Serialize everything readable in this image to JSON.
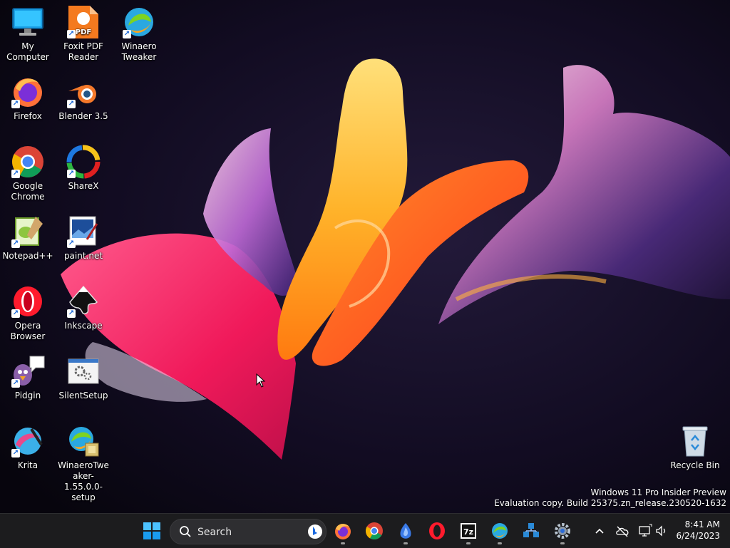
{
  "desktop": {
    "icons": [
      {
        "label": "My Computer",
        "icon": "computer-icon"
      },
      {
        "label": "Foxit PDF Reader",
        "icon": "foxit-pdf-icon"
      },
      {
        "label": "Winaero Tweaker",
        "icon": "winaero-tweaker-icon"
      },
      {
        "label": "Firefox",
        "icon": "firefox-icon"
      },
      {
        "label": "Blender 3.5",
        "icon": "blender-icon"
      },
      {
        "label": "Google Chrome",
        "icon": "chrome-icon"
      },
      {
        "label": "ShareX",
        "icon": "sharex-icon"
      },
      {
        "label": "Notepad++",
        "icon": "notepadpp-icon"
      },
      {
        "label": "paint.net",
        "icon": "paintnet-icon"
      },
      {
        "label": "Opera Browser",
        "icon": "opera-icon"
      },
      {
        "label": "Inkscape",
        "icon": "inkscape-icon"
      },
      {
        "label": "Pidgin",
        "icon": "pidgin-icon"
      },
      {
        "label": "SilentSetup",
        "icon": "silentsetup-icon"
      },
      {
        "label": "Krita",
        "icon": "krita-icon"
      },
      {
        "label": "WinaeroTweaker-1.55.0.0-setup",
        "icon": "winaero-setup-icon"
      },
      {
        "label": "Recycle Bin",
        "icon": "recycle-bin-icon"
      }
    ],
    "watermark": {
      "line1": "Windows 11 Pro Insider Preview",
      "line2": "Evaluation copy. Build 25375.zn_release.230520-1632"
    }
  },
  "taskbar": {
    "search_placeholder": "Search",
    "pinned": [
      "start-icon",
      "firefox-icon",
      "chrome-icon",
      "app-icon",
      "opera-icon",
      "7zip-icon",
      "winaero-tweaker-icon",
      "network-app-icon",
      "settings-icon"
    ],
    "tray": [
      "chevron-up-icon",
      "onedrive-icon",
      "network-icon",
      "volume-icon"
    ],
    "clock": {
      "time": "8:41 AM",
      "date": "6/24/2023"
    }
  },
  "colors": {
    "taskbar_bg": "#1c1c1e",
    "accent": "#0078d4",
    "wallpaper_bg": "#0b0716"
  }
}
